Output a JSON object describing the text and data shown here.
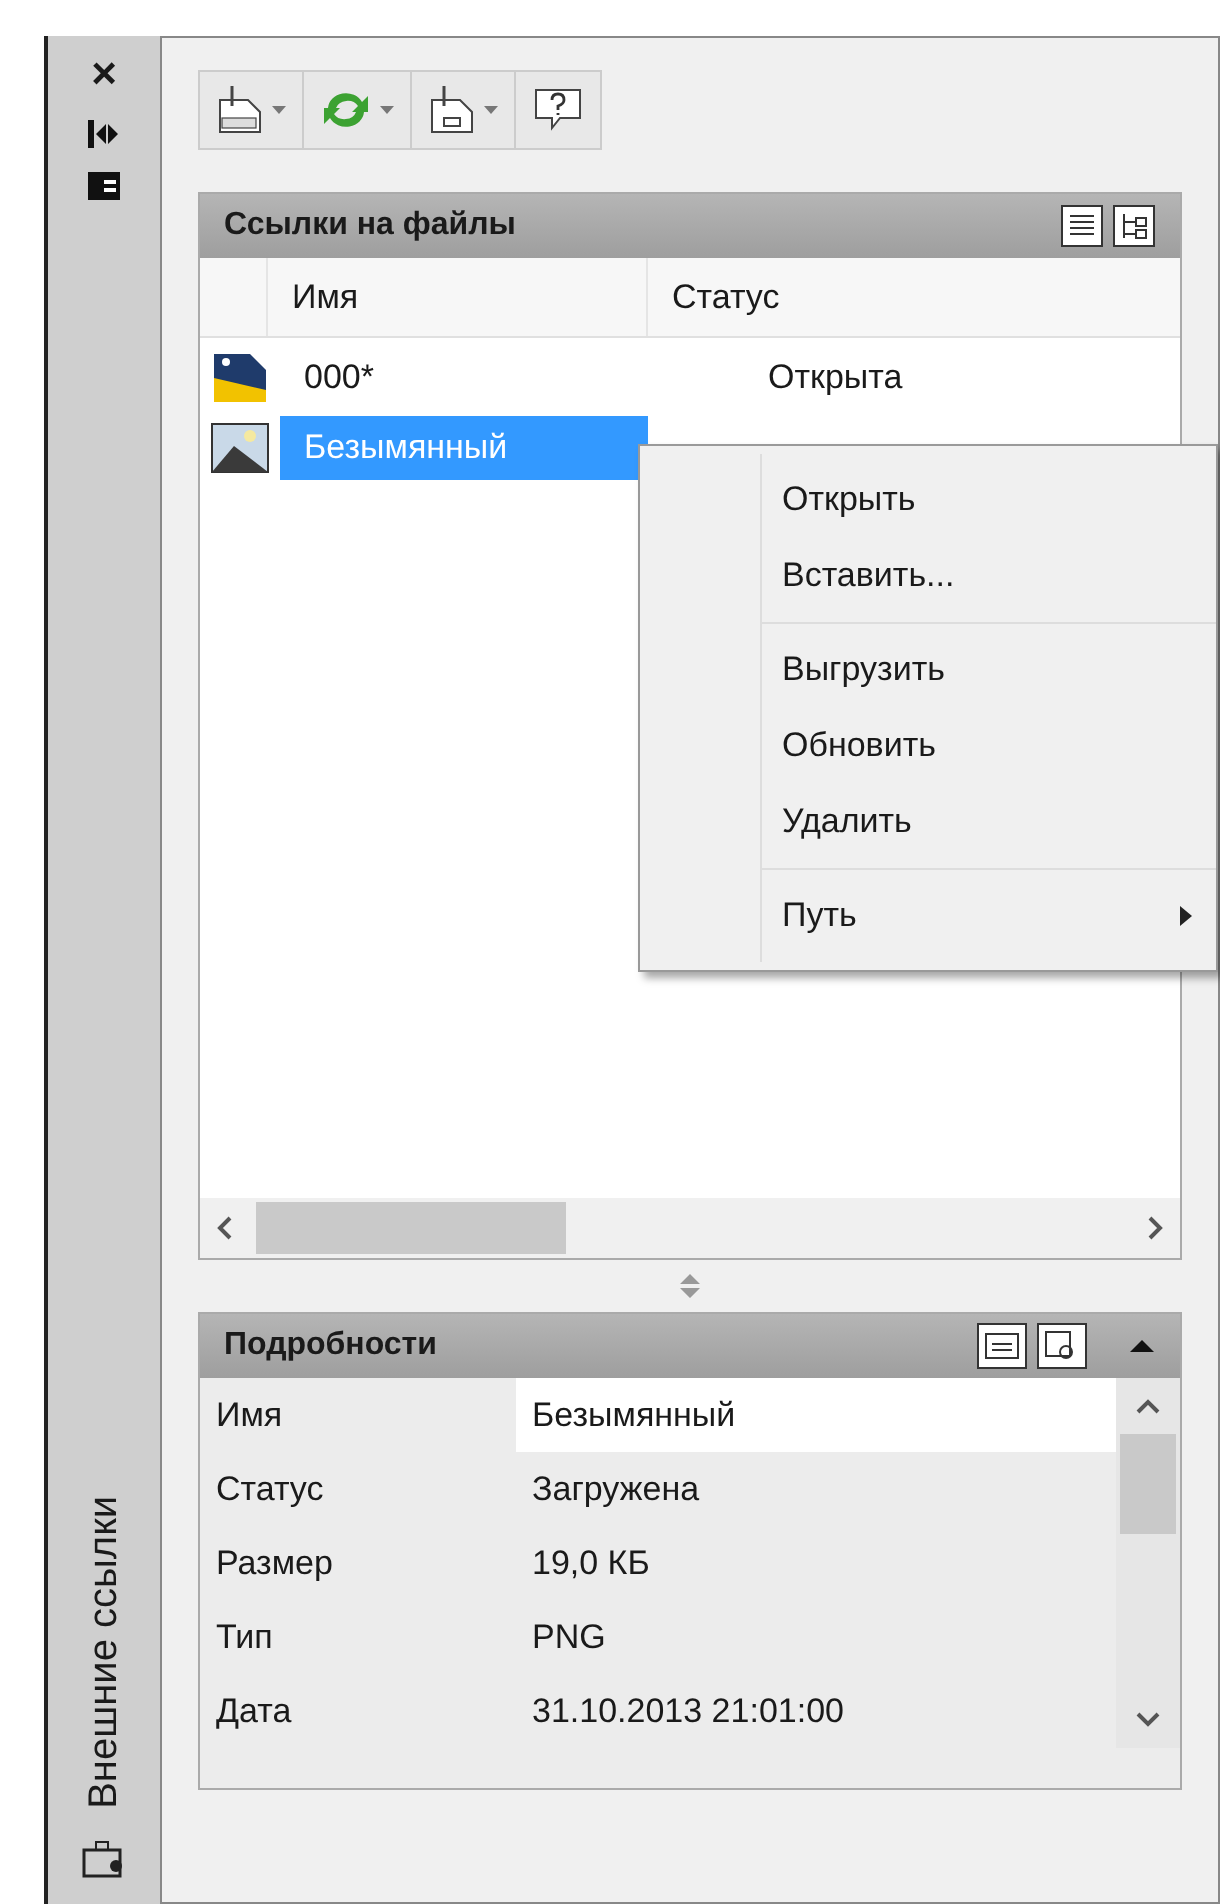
{
  "side_strip": {
    "close": "×",
    "title": "Внешние ссылки"
  },
  "file_refs": {
    "title": "Ссылки на файлы",
    "columns": [
      "Имя",
      "Статус"
    ],
    "rows": [
      {
        "kind": "drawing",
        "name": "000*",
        "status": "Открыта",
        "selected": false
      },
      {
        "kind": "image",
        "name": "Безымянный",
        "selected": true
      }
    ]
  },
  "context_menu": {
    "groups": [
      [
        {
          "label": "Открыть"
        },
        {
          "label": "Вставить..."
        }
      ],
      [
        {
          "label": "Выгрузить"
        },
        {
          "label": "Обновить"
        },
        {
          "label": "Удалить"
        }
      ],
      [
        {
          "label": "Путь",
          "submenu": true
        }
      ]
    ]
  },
  "details": {
    "title": "Подробности",
    "expanded": true,
    "rows": [
      {
        "label": "Имя",
        "value": "Безымянный",
        "kind": "edit"
      },
      {
        "label": "Статус",
        "value": "Загружена",
        "kind": "plain"
      },
      {
        "label": "Размер",
        "value": "19,0 КБ",
        "kind": "plain"
      },
      {
        "label": "Тип",
        "value": "PNG",
        "kind": "plain"
      },
      {
        "label": "Дата",
        "value": "31.10.2013 21:01:00",
        "kind": "plain"
      }
    ]
  }
}
